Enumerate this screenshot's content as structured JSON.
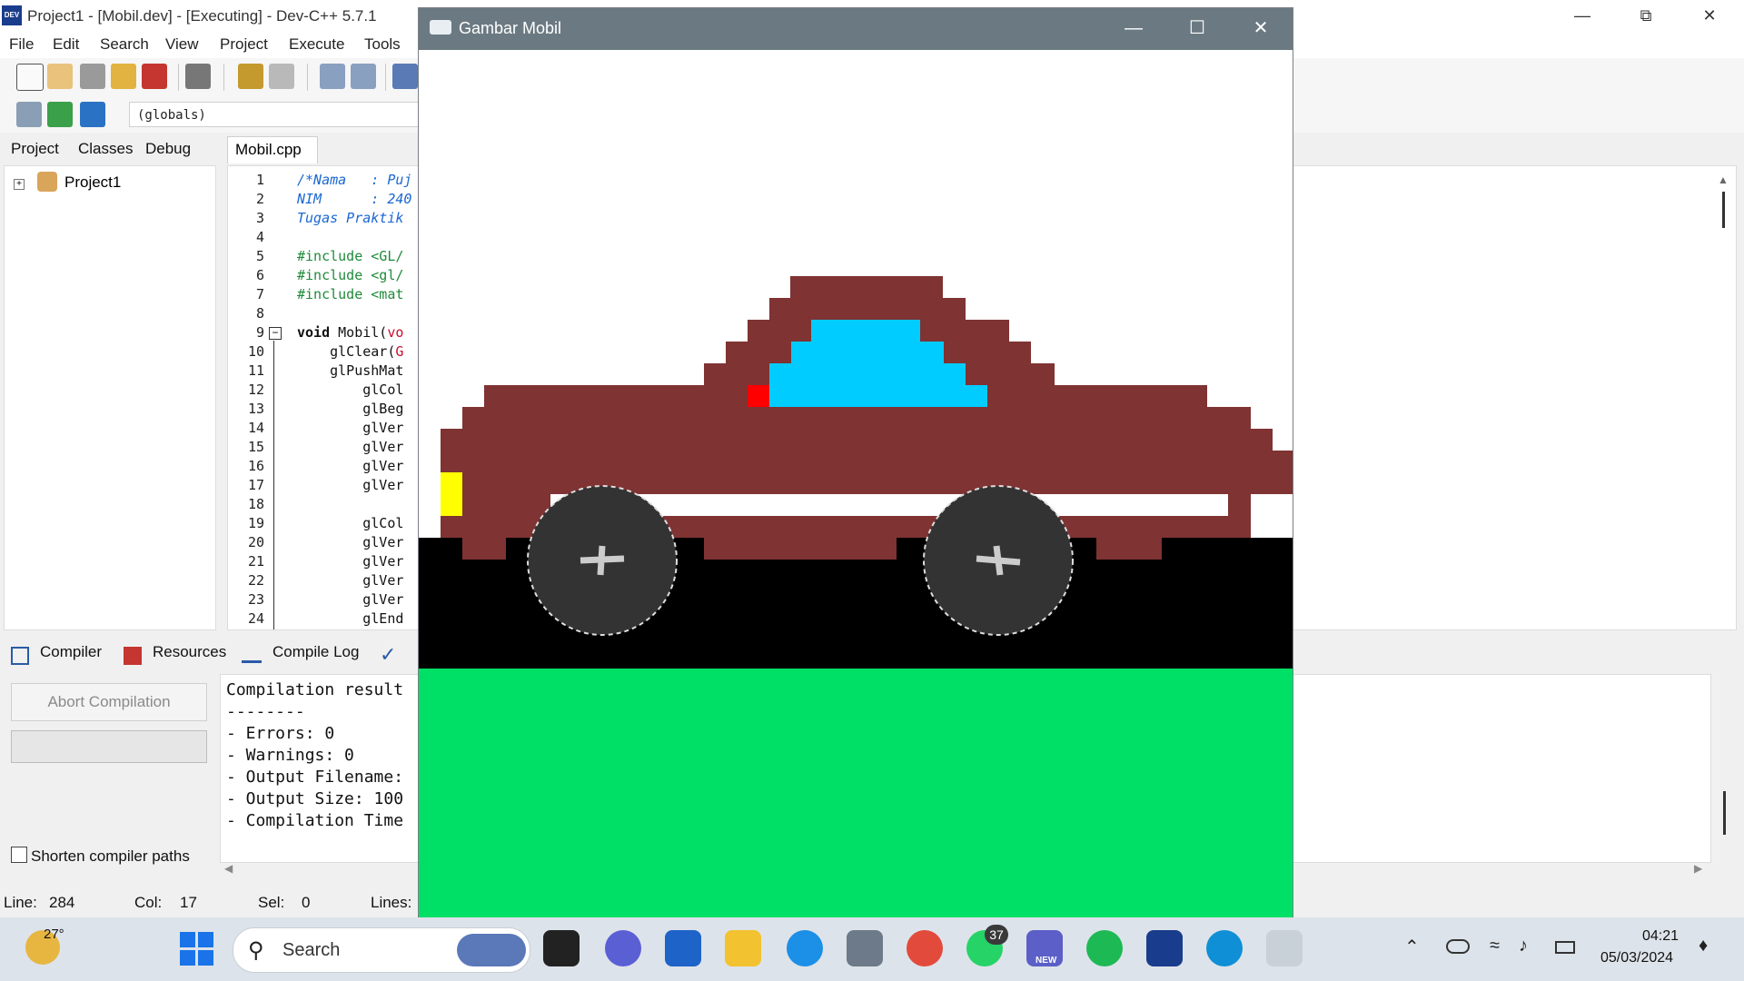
{
  "ide": {
    "title": "Project1 - [Mobil.dev] - [Executing] - Dev-C++ 5.7.1",
    "menu": [
      "File",
      "Edit",
      "Search",
      "View",
      "Project",
      "Execute",
      "Tools"
    ],
    "globals_combo": "(globals)",
    "left_tabs": [
      "Project",
      "Classes",
      "Debug"
    ],
    "project_tree": {
      "root": "Project1"
    },
    "editor_tab": "Mobil.cpp",
    "line_numbers": [
      "1",
      "2",
      "3",
      "4",
      "5",
      "6",
      "7",
      "8",
      "9",
      "10",
      "11",
      "12",
      "13",
      "14",
      "15",
      "16",
      "17",
      "18",
      "19",
      "20",
      "21",
      "22",
      "23",
      "24"
    ],
    "code": {
      "l1": "/*Nama   : Puj",
      "l2": "NIM      : 240",
      "l3": "Tugas Praktik",
      "l5": "#include <GL/",
      "l6": "#include <gl/",
      "l7": "#include <mat",
      "l9a": "void",
      "l9b": " Mobil(",
      "l9c": "vo",
      "l10a": "    glClear(",
      "l10b": "G",
      "l11": "    glPushMat",
      "l12": "        glCol",
      "l13": "        glBeg",
      "l14": "        glVer",
      "l15": "        glVer",
      "l16": "        glVer",
      "l17": "        glVer",
      "l19": "        glCol",
      "l20": "        glVer",
      "l21": "        glVer",
      "l22": "        glVer",
      "l23": "        glVer",
      "l24": "        glEnd"
    },
    "bottom_tabs": [
      "Compiler",
      "Resources",
      "Compile Log"
    ],
    "abort_button": "Abort Compilation",
    "shorten_paths": "Shorten compiler paths",
    "log": [
      "Compilation result",
      "--------",
      "- Errors: 0",
      "- Warnings: 0",
      "- Output Filename:",
      "- Output Size: 100",
      "- Compilation Time"
    ],
    "status": {
      "line_label": "Line:",
      "line_value": "284",
      "col_label": "Col:",
      "col_value": "17",
      "sel_label": "Sel:",
      "sel_value": "0",
      "lines_label": "Lines:"
    }
  },
  "gl_window": {
    "title": "Gambar Mobil",
    "colors": {
      "sky": "#ffffff",
      "road": "#000000",
      "grass": "#00e066",
      "car_body": "#7f3333",
      "window": "#00ccff",
      "stripe": "#ffffff",
      "headlight": "#ffff00",
      "mirror": "#ff0000",
      "wheel": "#333333"
    }
  },
  "taskbar": {
    "weather_temp": "27°",
    "search_placeholder": "Search",
    "whatsapp_badge": "37",
    "teams_badge": "NEW",
    "time": "04:21",
    "date": "05/03/2024"
  }
}
